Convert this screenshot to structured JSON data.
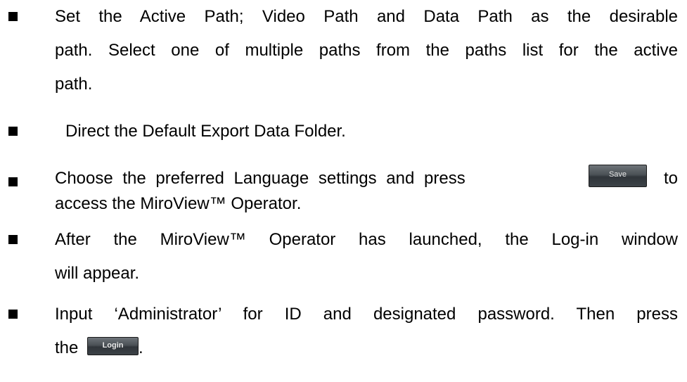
{
  "items": [
    {
      "lines": [
        "Set the Active Path; Video Path and Data Path as the desirable",
        "path. Select one of multiple paths from the paths list for the active",
        "path."
      ]
    },
    {
      "text": "Direct the Default Export Data Folder."
    },
    {
      "line1_before": "Choose the preferred Language settings and press",
      "save_label": "Save",
      "line1_after": "to",
      "line2": "access the MiroView™ Operator."
    },
    {
      "lines": [
        "After the MiroView™ Operator has launched, the Log-in window",
        "will appear."
      ]
    },
    {
      "line1": "Input ‘Administrator’ for ID and designated password. Then press",
      "line2_before": "the",
      "login_label": "Login",
      "line2_after": "."
    }
  ]
}
